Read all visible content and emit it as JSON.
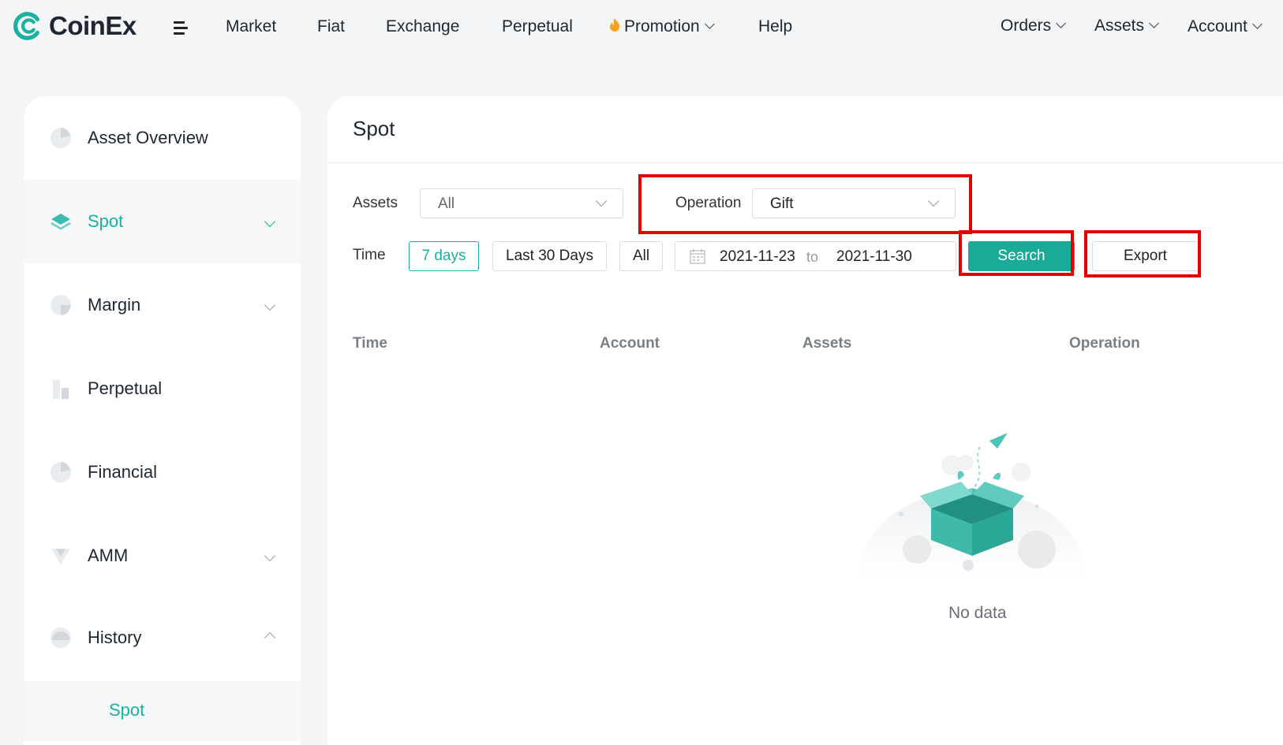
{
  "brand": {
    "name": "CoinEx",
    "accent": "#19b1a0"
  },
  "nav": {
    "items": [
      "Market",
      "Fiat",
      "Exchange",
      "Perpetual"
    ],
    "promotion": "Promotion",
    "help": "Help",
    "right": [
      "Orders",
      "Assets",
      "Account"
    ]
  },
  "sidebar": {
    "items": [
      {
        "label": "Asset Overview",
        "icon": "pie-chart-icon"
      },
      {
        "label": "Spot",
        "icon": "layers-icon",
        "active": true
      },
      {
        "label": "Margin",
        "icon": "pie-chart-icon"
      },
      {
        "label": "Perpetual",
        "icon": "bar-chart-icon"
      },
      {
        "label": "Financial",
        "icon": "pie-chart-icon"
      },
      {
        "label": "AMM",
        "icon": "funnel-icon"
      },
      {
        "label": "History",
        "icon": "half-circle-icon"
      }
    ],
    "history_sub": "Spot"
  },
  "main": {
    "title": "Spot",
    "filters": {
      "assets_label": "Assets",
      "assets_value": "All",
      "operation_label": "Operation",
      "operation_value": "Gift",
      "time_label": "Time",
      "time_options": [
        "7 days",
        "Last 30 Days",
        "All"
      ],
      "selected_time": "7 days",
      "date_start": "2021-11-23",
      "date_to": "to",
      "date_end": "2021-11-30",
      "search": "Search",
      "export": "Export"
    },
    "table": {
      "columns": [
        "Time",
        "Account",
        "Assets",
        "Operation"
      ]
    },
    "empty_text": "No data"
  }
}
